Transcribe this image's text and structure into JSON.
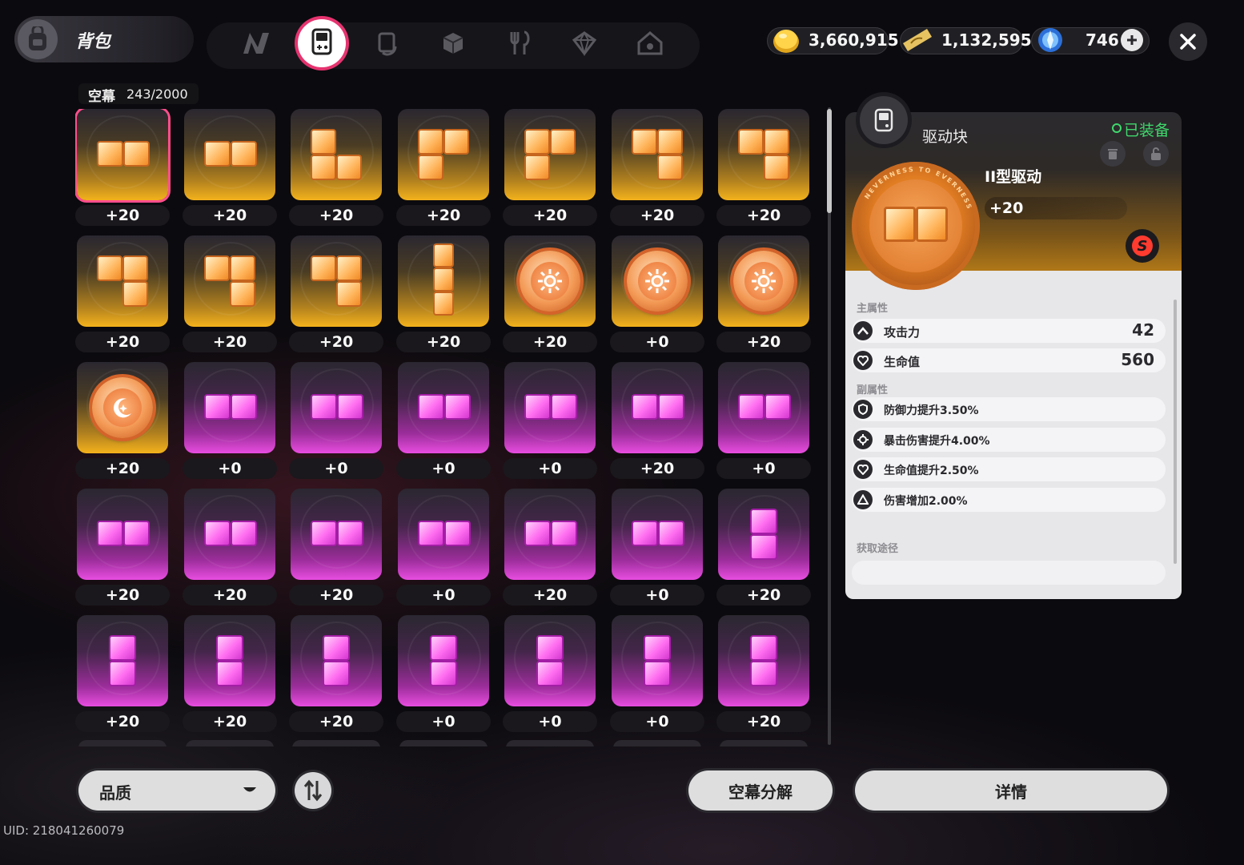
{
  "header": {
    "title": "背包",
    "tabs": [
      {
        "icon": "n-logo-icon"
      },
      {
        "icon": "handheld-console-icon",
        "active": true
      },
      {
        "icon": "cards-icon"
      },
      {
        "icon": "cube-icon"
      },
      {
        "icon": "fork-knife-icon"
      },
      {
        "icon": "gem-box-icon"
      },
      {
        "icon": "house-icon"
      }
    ],
    "currencies": [
      {
        "icon": "gold-coin-icon",
        "value": "3,660,915"
      },
      {
        "icon": "ticket-icon",
        "value": "1,132,595"
      },
      {
        "icon": "crystal-orb-icon",
        "value": "746"
      }
    ]
  },
  "inventory": {
    "label": "空幕",
    "count": "243/2000",
    "items": [
      {
        "shape": "h2",
        "rarity": "gold",
        "level": "+20",
        "selected": true
      },
      {
        "shape": "h2",
        "rarity": "gold",
        "level": "+20"
      },
      {
        "shape": "L",
        "rarity": "gold",
        "level": "+20"
      },
      {
        "shape": "gamma",
        "rarity": "gold",
        "level": "+20"
      },
      {
        "shape": "gamma",
        "rarity": "gold",
        "level": "+20"
      },
      {
        "shape": "seven",
        "rarity": "gold",
        "level": "+20"
      },
      {
        "shape": "seven",
        "rarity": "gold",
        "level": "+20"
      },
      {
        "shape": "seven",
        "rarity": "gold",
        "level": "+20"
      },
      {
        "shape": "seven",
        "rarity": "gold",
        "level": "+20"
      },
      {
        "shape": "seven",
        "rarity": "gold",
        "level": "+20"
      },
      {
        "shape": "v3",
        "rarity": "gold",
        "level": "+20"
      },
      {
        "shape": "coin-sun",
        "rarity": "gold",
        "level": "+20"
      },
      {
        "shape": "coin-sun",
        "rarity": "gold",
        "level": "+0"
      },
      {
        "shape": "coin-sun",
        "rarity": "gold",
        "level": "+20"
      },
      {
        "shape": "coin-moon",
        "rarity": "gold",
        "level": "+20"
      },
      {
        "shape": "h2",
        "rarity": "pink",
        "level": "+0"
      },
      {
        "shape": "h2",
        "rarity": "pink",
        "level": "+0"
      },
      {
        "shape": "h2",
        "rarity": "pink",
        "level": "+0"
      },
      {
        "shape": "h2",
        "rarity": "pink",
        "level": "+0"
      },
      {
        "shape": "h2",
        "rarity": "pink",
        "level": "+20"
      },
      {
        "shape": "h2",
        "rarity": "pink",
        "level": "+0"
      },
      {
        "shape": "h2",
        "rarity": "pink",
        "level": "+20"
      },
      {
        "shape": "h2",
        "rarity": "pink",
        "level": "+20"
      },
      {
        "shape": "h2",
        "rarity": "pink",
        "level": "+20"
      },
      {
        "shape": "h2",
        "rarity": "pink",
        "level": "+0"
      },
      {
        "shape": "h2",
        "rarity": "pink",
        "level": "+20"
      },
      {
        "shape": "h2",
        "rarity": "pink",
        "level": "+0"
      },
      {
        "shape": "v2",
        "rarity": "pink",
        "level": "+20"
      },
      {
        "shape": "v2",
        "rarity": "pink",
        "level": "+20"
      },
      {
        "shape": "v2",
        "rarity": "pink",
        "level": "+20"
      },
      {
        "shape": "v2",
        "rarity": "pink",
        "level": "+20"
      },
      {
        "shape": "v2",
        "rarity": "pink",
        "level": "+0"
      },
      {
        "shape": "v2",
        "rarity": "pink",
        "level": "+0"
      },
      {
        "shape": "v2",
        "rarity": "pink",
        "level": "+0"
      },
      {
        "shape": "v2",
        "rarity": "pink",
        "level": "+20"
      }
    ]
  },
  "detail": {
    "category": "驱动块",
    "status": "已装备",
    "name": "II型驱动",
    "level": "+20",
    "coin_text": "NEVERNESS TO EVERNESS",
    "main_title": "主属性",
    "main_stats": [
      {
        "icon": "attack-chevron-icon",
        "name": "攻击力",
        "value": "42"
      },
      {
        "icon": "heart-icon",
        "name": "生命值",
        "value": "560"
      }
    ],
    "sub_title": "副属性",
    "sub_stats": [
      {
        "icon": "shield-icon",
        "name": "防御力提升3.50%"
      },
      {
        "icon": "crosshair-icon",
        "name": "暴击伤害提升4.00%"
      },
      {
        "icon": "heart-icon",
        "name": "生命值提升2.50%"
      },
      {
        "icon": "triangle-icon",
        "name": "伤害增加2.00%"
      }
    ],
    "source_title": "获取途径"
  },
  "footer": {
    "filter_label": "品质",
    "dismantle_label": "空幕分解",
    "details_label": "详情",
    "uid": "UID: 218041260079"
  },
  "colors": {
    "accent": "#e6336f",
    "gold_rarity": "#f4b21c",
    "pink_rarity": "#e84de0",
    "equipped": "#3fd86c"
  }
}
